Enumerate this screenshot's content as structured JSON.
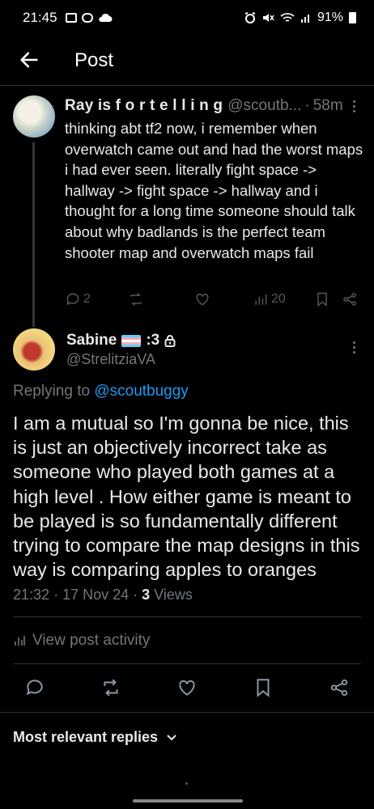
{
  "status_bar": {
    "time": "21:45",
    "battery": "91%"
  },
  "header": {
    "title": "Post"
  },
  "parent_post": {
    "author_name": "Ray is f o r t e l l i n g",
    "handle": "@scoutb...",
    "separator": "·",
    "time": "58m",
    "text": "thinking abt tf2 now, i remember when overwatch came out and had the worst maps i had ever seen. literally fight space -> hallway -> fight space -> hallway and i thought for a long time someone should talk about why badlands is the perfect team shooter map and overwatch maps fail",
    "replies": "2",
    "views": "20"
  },
  "main_post": {
    "author_name": "Sabine",
    "name_suffix": ":3",
    "handle": "@StrelitziaVA",
    "replying_prefix": "Replying to",
    "replying_to": "@scoutbuggy",
    "text": "I am a mutual so I'm gonna be nice, this is just an objectively incorrect take as someone who played both games at a high level . How either game is meant to be played is so fundamentally different trying to compare the map designs in this way is comparing apples to oranges",
    "time": "21:32",
    "date": "17 Nov 24",
    "separator": "·",
    "views_count": "3",
    "views_label": "Views",
    "view_activity": "View post activity"
  },
  "replies_sort": {
    "label": "Most relevant replies"
  },
  "colors": {
    "background": "#000000",
    "text": "#e7e9ea",
    "secondary": "#71767b",
    "link": "#1d9bf0",
    "divider": "#2f3336"
  }
}
